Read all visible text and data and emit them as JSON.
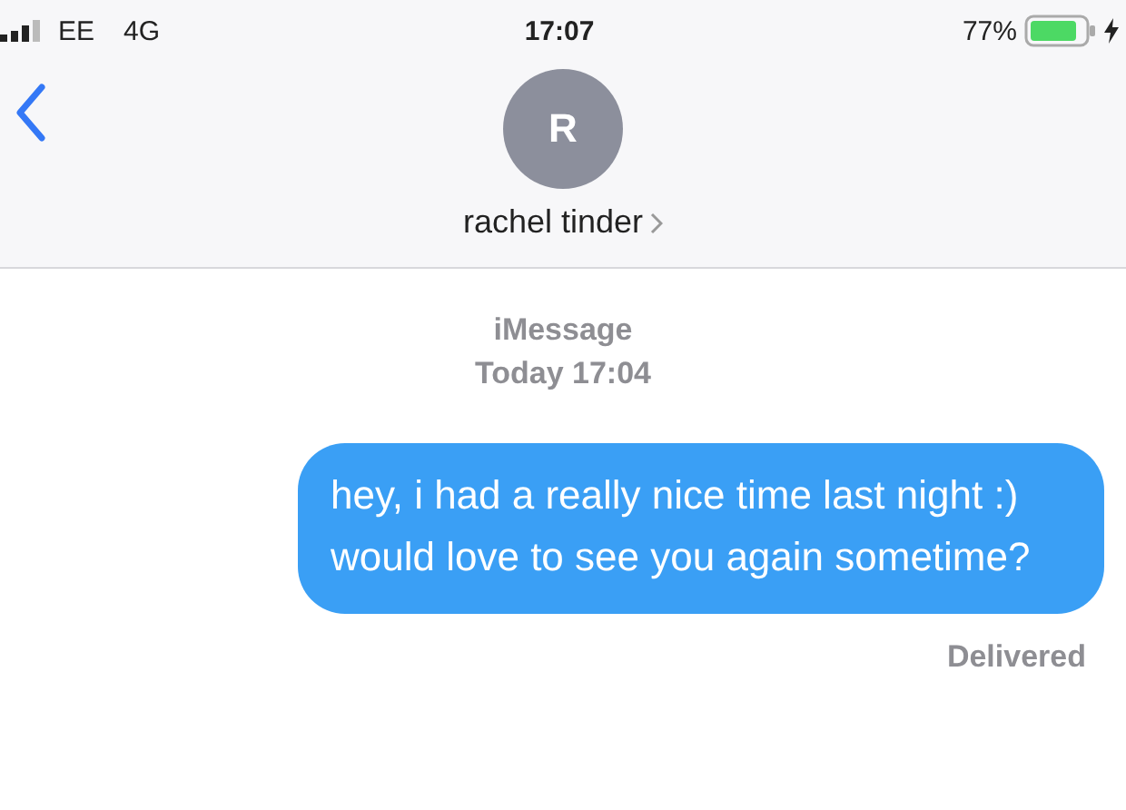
{
  "status_bar": {
    "carrier": "EE",
    "network": "4G",
    "time": "17:07",
    "battery": "77%",
    "charging": true
  },
  "header": {
    "avatar_initial": "R",
    "contact_name": "rachel tinder"
  },
  "thread": {
    "service": "iMessage",
    "timestamp": "Today 17:04",
    "messages": [
      {
        "kind": "sent",
        "text": "hey, i had a really nice time last night :) would love to see you again sometime?"
      }
    ],
    "receipt": "Delivered"
  }
}
